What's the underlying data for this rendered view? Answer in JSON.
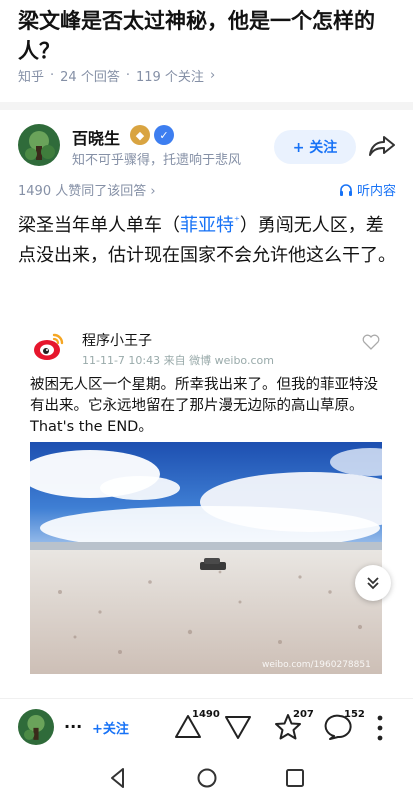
{
  "question": {
    "title": "梁文峰是否太过神秘，他是一个怎样的人？",
    "meta": [
      "知乎",
      "24 个回答",
      "119 个关注"
    ],
    "chevron": "›"
  },
  "author": {
    "name": "百晓生",
    "bio": "知不可乎骤得，托遗响于悲风",
    "follow_label": "+ 关注",
    "badge_icons": [
      "level-badge-icon",
      "verified-badge-icon"
    ]
  },
  "answer": {
    "agree_text": "1490 人赞同了该回答 ›",
    "listen_label": "听内容",
    "text_before": "梁圣当年单人单车（",
    "tag": "菲亚特",
    "tag_mark": "⁺",
    "text_after": "）勇闯无人区，差点没出来，估计现在国家不会允许他这么干了。"
  },
  "weibo": {
    "username": "程序小王子",
    "time_source": "11-11-7 10:43  来自 微博 weibo.com",
    "text": "被困无人区一个星期。所幸我出来了。但我的菲亚特没有出来。它永远地留在了那片漫无边际的高山草原。That's the END。",
    "watermark": "weibo.com/1960278851"
  },
  "bottom_bar": {
    "dots": "...",
    "follow_label": "+关注",
    "agree_count": "1490",
    "like_count": "207",
    "comment_count": "152"
  },
  "colors": {
    "accent": "#1772f6",
    "muted": "#8590a6",
    "weibo_red": "#e6162d"
  }
}
